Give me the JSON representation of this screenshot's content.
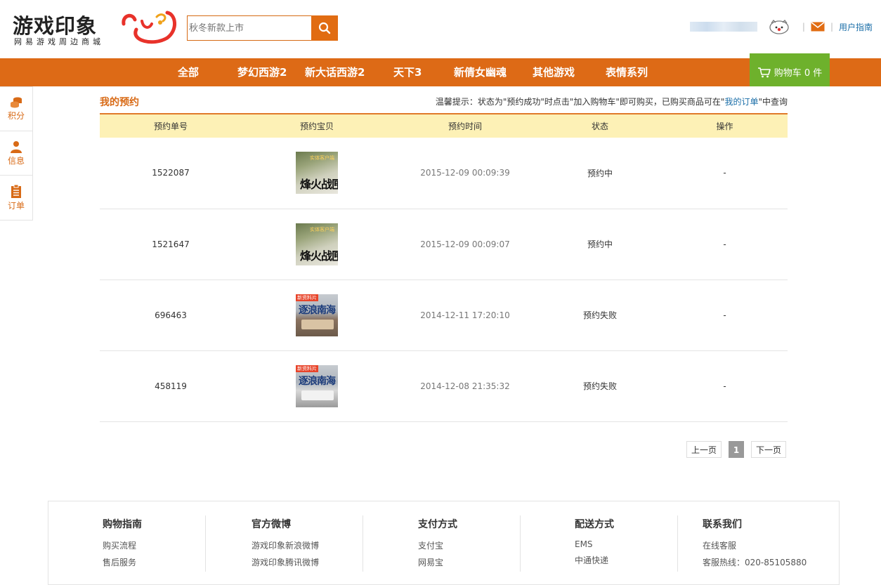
{
  "header": {
    "logo_main": "游戏印象",
    "logo_sub": "网易游戏周边商城",
    "search_placeholder": "秋冬新款上市",
    "user_guide": "用户指南"
  },
  "nav": {
    "items": [
      "全部",
      "梦幻西游2",
      "新大话西游2",
      "天下3",
      "新倩女幽魂",
      "其他游戏",
      "表情系列"
    ],
    "cart_label": "购物车 0 件"
  },
  "side": {
    "items": [
      "积分",
      "信息",
      "订单"
    ]
  },
  "main": {
    "title": "我的预约",
    "tip_prefix": "温馨提示：状态为\"预约成功\"时点击\"加入购物车\"即可购买，已购买商品可在\"",
    "tip_link": "我的订单",
    "tip_suffix": "\"中查询",
    "columns": [
      "预约单号",
      "预约宝贝",
      "预约时间",
      "状态",
      "操作"
    ],
    "rows": [
      {
        "id": "1522087",
        "time": "2015-12-09 00:09:39",
        "status": "预约中",
        "op": "-",
        "thumb_top": "实体客户端",
        "thumb_main": "烽火战匣"
      },
      {
        "id": "1521647",
        "time": "2015-12-09 00:09:07",
        "status": "预约中",
        "op": "-",
        "thumb_top": "实体客户端",
        "thumb_main": "烽火战匣"
      },
      {
        "id": "696463",
        "time": "2014-12-11 17:20:10",
        "status": "预约失败",
        "op": "-",
        "thumb_top": "新资料片",
        "thumb_main": "逐浪南海"
      },
      {
        "id": "458119",
        "time": "2014-12-08 21:35:32",
        "status": "预约失败",
        "op": "-",
        "thumb_top": "新资料片",
        "thumb_main": "逐浪南海"
      }
    ]
  },
  "pager": {
    "prev": "上一页",
    "current": "1",
    "next": "下一页"
  },
  "footer": {
    "columns": [
      {
        "title": "购物指南",
        "links": [
          "购买流程",
          "售后服务"
        ]
      },
      {
        "title": "官方微博",
        "links": [
          "游戏印象新浪微博",
          "游戏印象腾讯微博"
        ]
      },
      {
        "title": "支付方式",
        "links": [
          "支付宝",
          "网易宝"
        ]
      },
      {
        "title": "配送方式",
        "links": [
          "EMS",
          "中通快递"
        ]
      },
      {
        "title": "联系我们",
        "links": [
          "在线客服",
          "客服热线：020-85105880"
        ]
      }
    ]
  },
  "colors": {
    "brand_orange": "#dd6a16",
    "cart_green": "#6eb12c",
    "header_row": "#fdf1b6",
    "link_blue": "#1a6ea8"
  }
}
